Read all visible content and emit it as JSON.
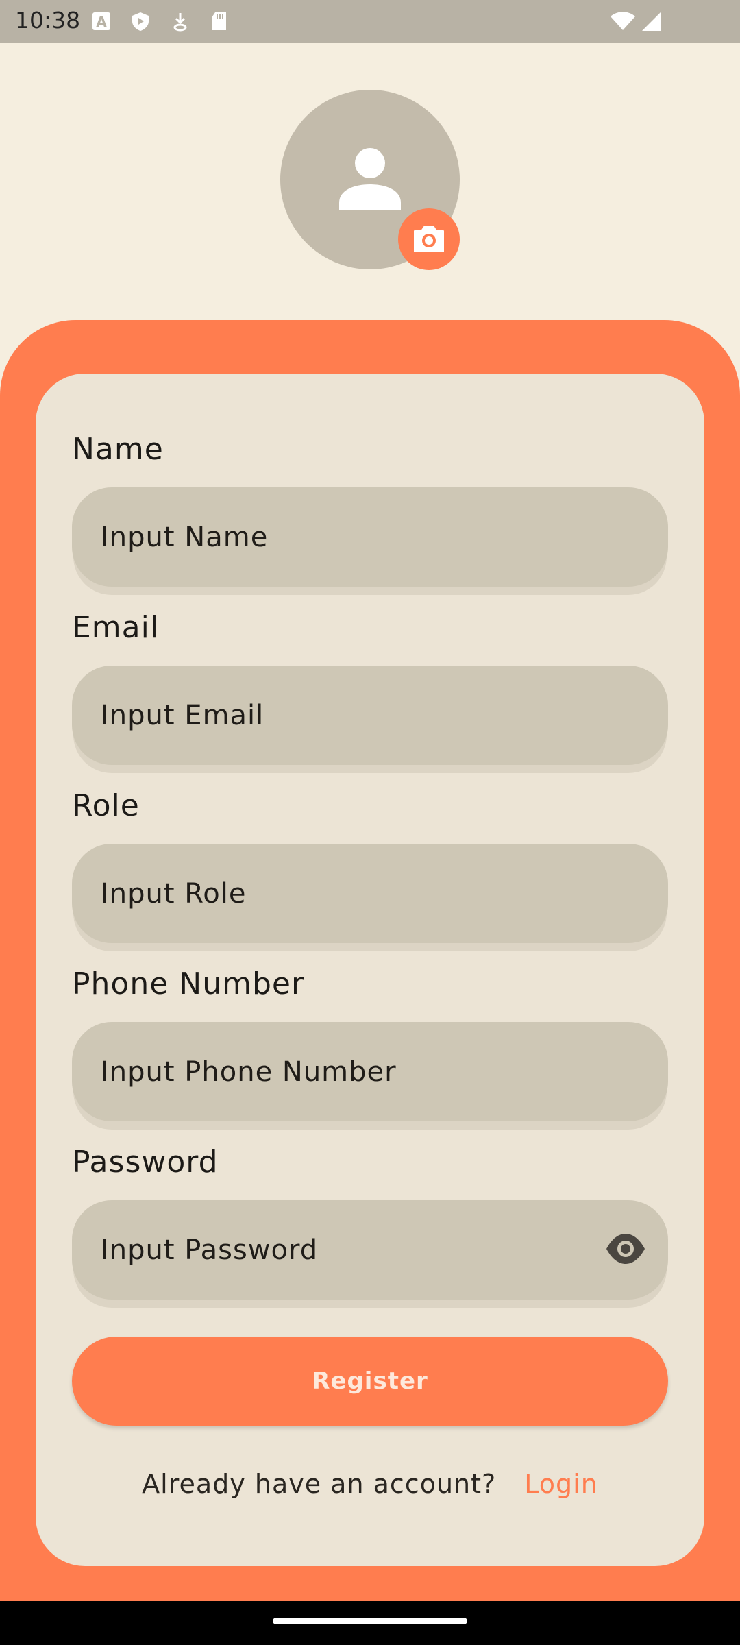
{
  "status_bar": {
    "time": "10:38",
    "icons": [
      "font-a-icon",
      "shield-play-icon",
      "download-icon",
      "sd-card-icon",
      "wifi-icon",
      "signal-icon"
    ]
  },
  "profile": {
    "avatar_icon": "person-icon",
    "camera_icon": "camera-icon"
  },
  "form": {
    "name": {
      "label": "Name",
      "placeholder": "Input Name",
      "value": ""
    },
    "email": {
      "label": "Email",
      "placeholder": "Input Email",
      "value": ""
    },
    "role": {
      "label": "Role",
      "placeholder": "Input Role",
      "value": ""
    },
    "phone": {
      "label": "Phone Number",
      "placeholder": "Input Phone Number",
      "value": ""
    },
    "password": {
      "label": "Password",
      "placeholder": "Input Password",
      "value": "",
      "toggle_icon": "eye-icon"
    },
    "register_label": "Register"
  },
  "footer": {
    "prompt": "Already have an account?",
    "login_label": "Login"
  },
  "colors": {
    "accent": "#FF7D4F",
    "background": "#F5EEDF",
    "card": "#ECE4D5",
    "field": "#CEC7B5"
  }
}
